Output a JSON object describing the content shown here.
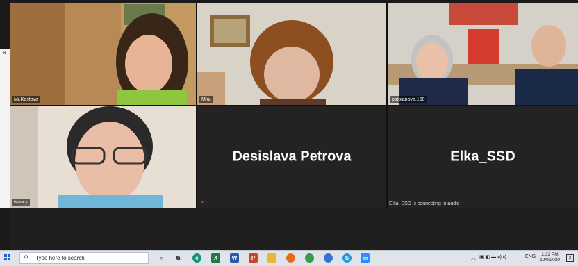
{
  "participants": [
    {
      "name": "Mr.Kostova"
    },
    {
      "name": "Mira"
    },
    {
      "name": "pstoianova.150"
    },
    {
      "name": "Nancy"
    },
    {
      "name": "Desislava Petrova"
    },
    {
      "name": "Elka_SSD",
      "status": "Elka_SSD is connecting to audio"
    }
  ],
  "taskbar": {
    "search_placeholder": "Type here to search",
    "language": "ENG",
    "time": "2:32 PM",
    "date": "12/9/2020",
    "notification_count": "2"
  },
  "colors": {
    "active_speaker_border": "#c9d94a",
    "taskbar_bg": "#dfe3ea"
  }
}
